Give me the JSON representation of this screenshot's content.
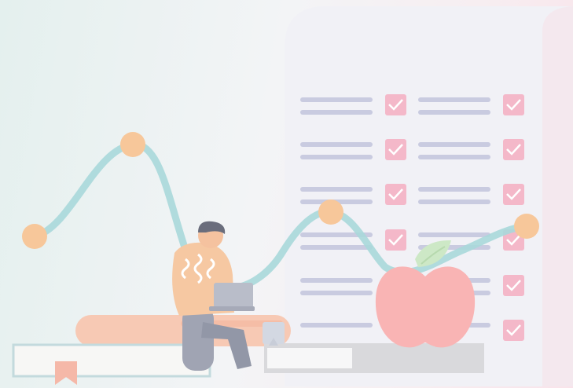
{
  "illustration": {
    "subject": "person-with-laptop-icon",
    "checklist_icon": "checklist-icon",
    "apple_icon": "apple-icon",
    "books_icon": "books-icon",
    "trend_icon": "trend-line-icon",
    "colors": {
      "paper": "#f1f1f6",
      "paper_shadow": "#e4e3ec",
      "row_line": "#c9cbe0",
      "checkbox": "#f4b8c9",
      "check": "#ffffff",
      "curve": "#a9d8da",
      "node": "#f7c79a",
      "apple": "#f9b4b4",
      "leaf": "#cde8c6",
      "book_coral": "#f7c9b4",
      "book_cream": "#f7f7f5",
      "book_dark": "#d9d9dc",
      "shirt": "#f6c8a2",
      "hair": "#6a6d7c",
      "pants": "#a0a4b3",
      "laptop": "#b9bdc9"
    }
  }
}
